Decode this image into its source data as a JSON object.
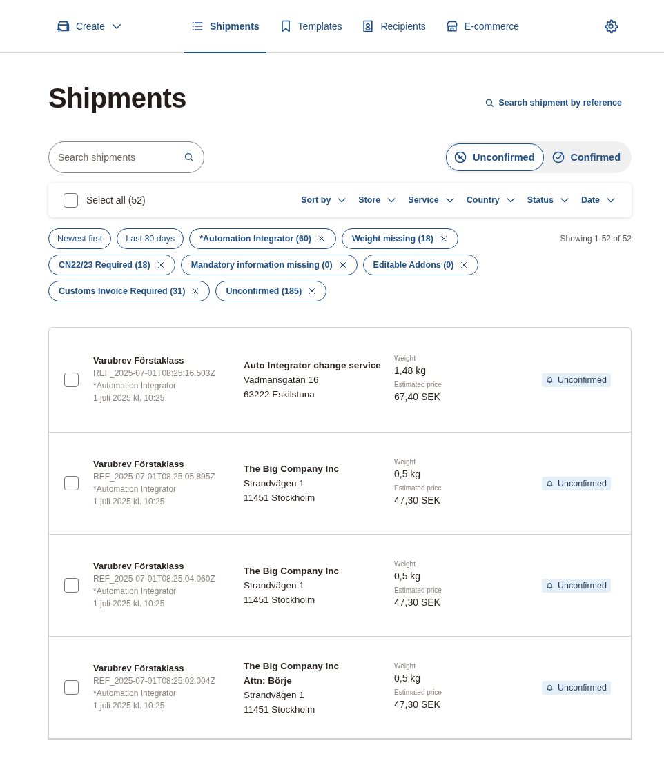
{
  "nav": {
    "create": "Create",
    "items": [
      {
        "label": "Shipments",
        "selected": true
      },
      {
        "label": "Templates",
        "selected": false
      },
      {
        "label": "Recipients",
        "selected": false
      },
      {
        "label": "E-commerce",
        "selected": false
      }
    ]
  },
  "title": "Shipments",
  "reference_search": "Search shipment by reference",
  "search": {
    "placeholder": "Search shipments"
  },
  "toggle": [
    {
      "label": "Unconfirmed",
      "selected": true
    },
    {
      "label": "Confirmed",
      "selected": false
    }
  ],
  "toolbar": {
    "select_all": "Select all (52)",
    "checked": false,
    "dropdowns": [
      "Sort by",
      "Store",
      "Service",
      "Country",
      "Status",
      "Date"
    ]
  },
  "chips": [
    {
      "label": "Newest first",
      "removable": false
    },
    {
      "label": "Last 30 days",
      "removable": false
    },
    {
      "label": "*Automation Integrator (60)",
      "removable": true
    },
    {
      "label": "Weight missing (18)",
      "removable": true
    },
    {
      "label": "CN22/23 Required (18)",
      "removable": true
    },
    {
      "label": "Mandatory information missing (0)",
      "removable": true
    },
    {
      "label": "Editable Addons (0)",
      "removable": true
    },
    {
      "label": "Customs Invoice Required (31)",
      "removable": true
    },
    {
      "label": "Unconfirmed (185)",
      "removable": true
    }
  ],
  "showing": "Showing 1-52 of 52",
  "shipments": [
    {
      "checked": false,
      "service": "Varubrev Förstaklass",
      "ref": "REF_2025-07-01T08:25:16.503Z",
      "integration": "*Automation Integrator",
      "date": "1 juli 2025 kl. 10:25",
      "recipient": [
        "Auto Integrator change service"
      ],
      "address": [
        "Vadmansgatan 16",
        "63222 Eskilstuna"
      ],
      "weight_label": "Weight",
      "weight": "1,48 kg",
      "price_label": "Estimated price",
      "price": "67,40 SEK",
      "status": "Unconfirmed"
    },
    {
      "checked": false,
      "service": "Varubrev Förstaklass",
      "ref": "REF_2025-07-01T08:25:05.895Z",
      "integration": "*Automation Integrator",
      "date": "1 juli 2025 kl. 10:25",
      "recipient": [
        "The Big Company Inc"
      ],
      "address": [
        "Strandvägen 1",
        "11451 Stockholm"
      ],
      "weight_label": "Weight",
      "weight": "0,5 kg",
      "price_label": "Estimated price",
      "price": "47,30 SEK",
      "status": "Unconfirmed"
    },
    {
      "checked": false,
      "service": "Varubrev Förstaklass",
      "ref": "REF_2025-07-01T08:25:04.060Z",
      "integration": "*Automation Integrator",
      "date": "1 juli 2025 kl. 10:25",
      "recipient": [
        "The Big Company Inc"
      ],
      "address": [
        "Strandvägen 1",
        "11451 Stockholm"
      ],
      "weight_label": "Weight",
      "weight": "0,5 kg",
      "price_label": "Estimated price",
      "price": "47,30 SEK",
      "status": "Unconfirmed"
    },
    {
      "checked": false,
      "service": "Varubrev Förstaklass",
      "ref": "REF_2025-07-01T08:25:02.004Z",
      "integration": "*Automation Integrator",
      "date": "1 juli 2025 kl. 10:25",
      "recipient": [
        "The Big Company Inc",
        "Attn: Börje"
      ],
      "address": [
        "Strandvägen 1",
        "11451 Stockholm"
      ],
      "weight_label": "Weight",
      "weight": "0,5 kg",
      "price_label": "Estimated price",
      "price": "47,30 SEK",
      "status": "Unconfirmed"
    }
  ]
}
